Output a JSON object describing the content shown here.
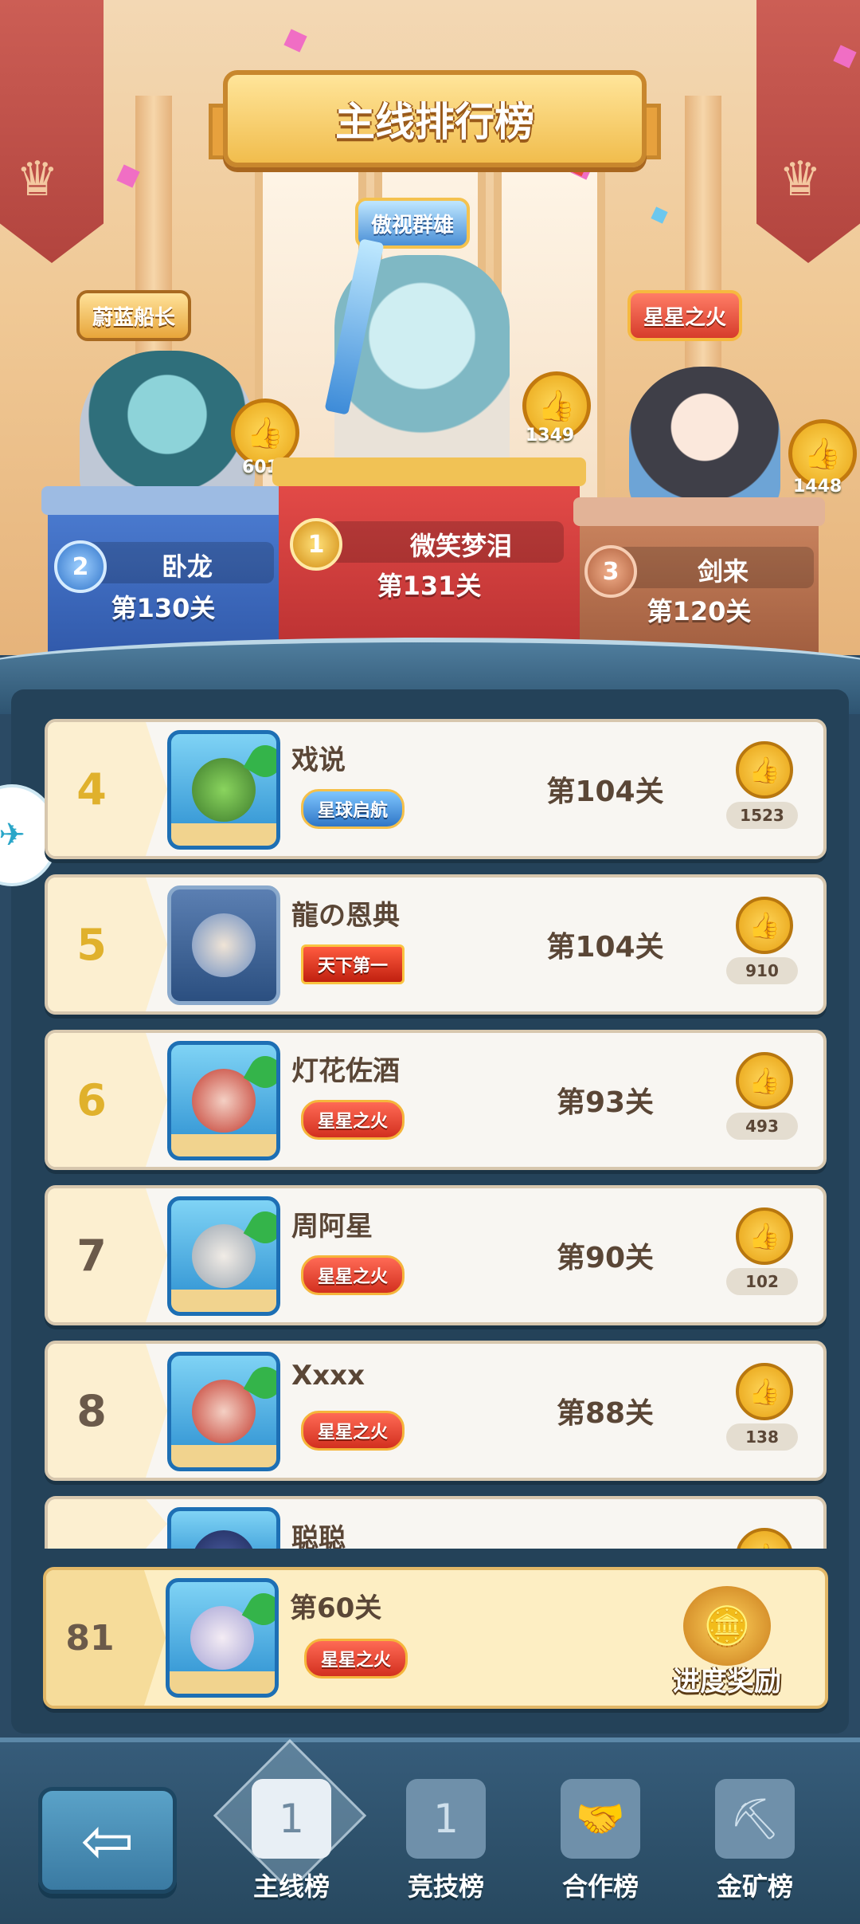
{
  "header": {
    "title": "主线排行榜"
  },
  "podium": {
    "first": {
      "rank": "1",
      "badge": "傲视群雄",
      "name": "微笑梦泪",
      "level": "第131关",
      "likes": "1349"
    },
    "second": {
      "rank": "2",
      "badge": "蔚蓝船长",
      "name": "卧龙",
      "level": "第130关",
      "likes": "601"
    },
    "third": {
      "rank": "3",
      "badge": "星星之火",
      "name": "剑来",
      "level": "第120关",
      "likes": "1448"
    }
  },
  "rows": [
    {
      "rank": "4",
      "name": "戏说",
      "title": "星球启航",
      "level": "第104关",
      "likes": "1523"
    },
    {
      "rank": "5",
      "name": "龍の恩典",
      "title": "天下第一",
      "level": "第104关",
      "likes": "910"
    },
    {
      "rank": "6",
      "name": "灯花佐酒",
      "title": "星星之火",
      "level": "第93关",
      "likes": "493"
    },
    {
      "rank": "7",
      "name": "周阿星",
      "title": "星星之火",
      "level": "第90关",
      "likes": "102"
    },
    {
      "rank": "8",
      "name": "Xxxx",
      "title": "星星之火",
      "level": "第88关",
      "likes": "138"
    },
    {
      "rank": "",
      "name": "聪聪",
      "title": "",
      "level": "",
      "likes": ""
    }
  ],
  "my_rank": {
    "rank": "81",
    "level": "第60关",
    "title": "星星之火",
    "reward_label": "进度奖励"
  },
  "nav": {
    "back_icon": "back-arrow-icon",
    "tabs": [
      {
        "label": "主线榜",
        "icon": "podium-icon",
        "active": true
      },
      {
        "label": "竞技榜",
        "icon": "trophy-icon",
        "active": false
      },
      {
        "label": "合作榜",
        "icon": "handshake-icon",
        "active": false
      },
      {
        "label": "金矿榜",
        "icon": "mine-cart-icon",
        "active": false
      }
    ]
  },
  "colors": {
    "rank_gold": "#e0b12c",
    "rank_brown": "#6b5a4a",
    "accent_blue": "#2f76c6",
    "accent_red": "#d2301f"
  }
}
